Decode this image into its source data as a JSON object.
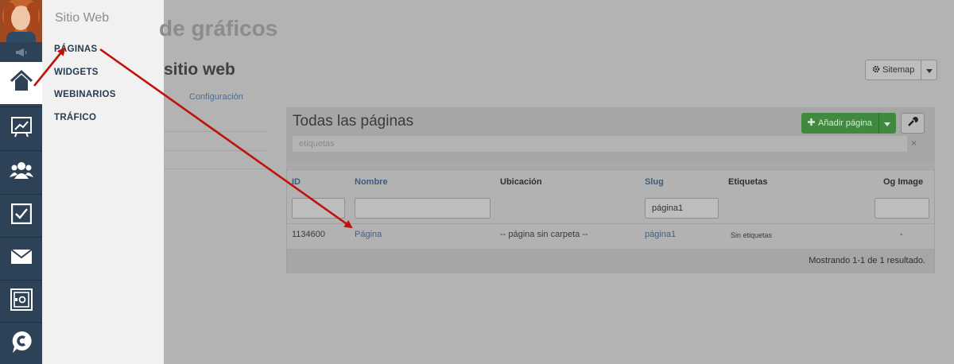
{
  "rail": {
    "items": [
      {
        "icon": "home-icon",
        "active": true
      },
      {
        "icon": "chart-icon"
      },
      {
        "icon": "users-icon"
      },
      {
        "icon": "checkbox-icon"
      },
      {
        "icon": "mail-icon"
      },
      {
        "icon": "safe-icon"
      },
      {
        "icon": "chat-c-icon"
      }
    ]
  },
  "submenu": {
    "title": "Sitio Web",
    "items": [
      "PÁGINAS",
      "WIDGETS",
      "WEBINARIOS",
      "TRÁFICO"
    ]
  },
  "page": {
    "heading": "de gráficos",
    "section": "sitio web",
    "tab_config": "Configuración",
    "sitemap_label": "Sitemap"
  },
  "panel": {
    "title": "Todas las páginas",
    "add_label": "Añadir página",
    "tag_placeholder": "etiquetas",
    "tag_clear": "×"
  },
  "table": {
    "headers": {
      "id": "ID",
      "name": "Nombre",
      "location": "Ubicación",
      "slug": "Slug",
      "tags": "Etiquetas",
      "og": "Og Image"
    },
    "filters": {
      "slug_value": "página1"
    },
    "rows": [
      {
        "id": "1134600",
        "name": "Página",
        "location": "-- página sin carpeta --",
        "slug": "página1",
        "tags": "Sin etiquetas",
        "og": "-"
      }
    ],
    "footer": "Mostrando 1-1 de 1 resultado."
  },
  "colors": {
    "rail": "#2d4256",
    "submenu_bg": "#f1f1f1",
    "overlay_bg": "#b3b3b3",
    "annotation_arrow": "#c0120b",
    "add_button": "#3f8a3f"
  }
}
